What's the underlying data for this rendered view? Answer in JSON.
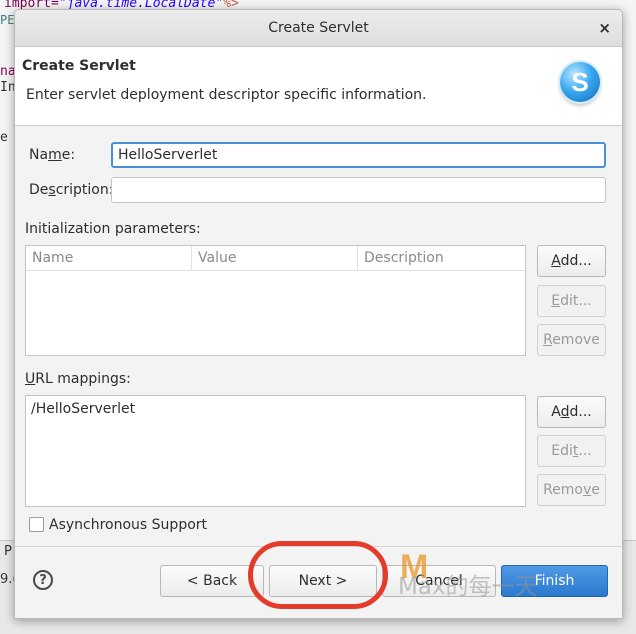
{
  "background": {
    "code_line_1": {
      "prefix": "import=",
      "string": "\"java.time.LocalDate\"",
      "suffix": "%>"
    },
    "code_line_2": "PE",
    "code_line_3": "na",
    "code_line_4": "In",
    "code_line_5": "e",
    "bottom_text_1": "P",
    "bottom_text_2": "9.("
  },
  "dialog": {
    "title": "Create Servlet",
    "close_glyph": "×",
    "header": {
      "title": "Create Servlet",
      "description": "Enter servlet deployment descriptor specific information.",
      "logo_letter": "S"
    },
    "name": {
      "label_pre": "Na",
      "label_mnemonic": "m",
      "label_post": "e:",
      "value": "HelloServerlet"
    },
    "description": {
      "label_pre": "De",
      "label_mnemonic": "s",
      "label_post": "cription:",
      "value": ""
    },
    "init_params": {
      "label": "Initialization parameters:",
      "columns": [
        "Name",
        "Value",
        "Description"
      ],
      "buttons": {
        "add": {
          "mnemonic": "A",
          "rest": "dd..."
        },
        "edit": {
          "mnemonic": "E",
          "rest": "dit..."
        },
        "remove": {
          "mnemonic": "R",
          "rest": "emove"
        }
      }
    },
    "url_mappings": {
      "label_mnemonic": "U",
      "label_rest": "RL mappings:",
      "items": [
        "/HelloServerlet"
      ],
      "buttons": {
        "add": {
          "pre": "A",
          "mnemonic": "d",
          "rest": "d..."
        },
        "edit": {
          "pre": "Edi",
          "mnemonic": "t",
          "rest": "..."
        },
        "remove": {
          "pre": "Remo",
          "mnemonic": "v",
          "rest": "e"
        }
      }
    },
    "async": {
      "label": "Asynchronous Support",
      "checked": false
    },
    "footer": {
      "help_glyph": "?",
      "back": "< Back",
      "next": "Next >",
      "cancel": "Cancel",
      "finish": "Finish"
    }
  },
  "overlay": {
    "watermark_text": "Max的每一天",
    "watermark_logo": "M",
    "ring_color": "#e53b2a"
  },
  "colors": {
    "primary_button": "#2b79cf",
    "focus_border": "#4a90d9"
  }
}
